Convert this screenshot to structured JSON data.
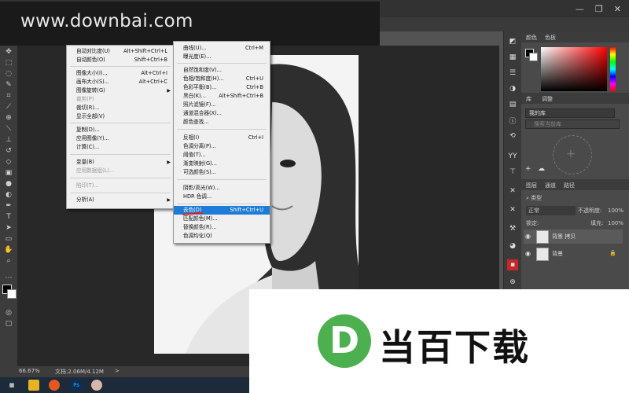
{
  "watermark": {
    "text": "www.downbai.com"
  },
  "image_menu": {
    "items": [
      {
        "label": "自动对比度(U)",
        "shortcut": "Alt+Shift+Ctrl+L",
        "disabled": false
      },
      {
        "label": "自动颜色(O)",
        "shortcut": "Shift+Ctrl+B",
        "disabled": false
      },
      {
        "label": "图像大小(I)...",
        "shortcut": "Alt+Ctrl+I",
        "disabled": false
      },
      {
        "label": "画布大小(S)...",
        "shortcut": "Alt+Ctrl+C",
        "disabled": false
      },
      {
        "label": "图像旋转(G)",
        "shortcut": "",
        "disabled": false
      },
      {
        "label": "裁剪(P)",
        "shortcut": "",
        "disabled": true
      },
      {
        "label": "裁切(R)...",
        "shortcut": "",
        "disabled": false
      },
      {
        "label": "显示全部(V)",
        "shortcut": "",
        "disabled": false
      },
      {
        "label": "复制(D)...",
        "shortcut": "",
        "disabled": false
      },
      {
        "label": "应用图像(Y)...",
        "shortcut": "",
        "disabled": false
      },
      {
        "label": "计算(C)...",
        "shortcut": "",
        "disabled": false
      },
      {
        "label": "变量(B)",
        "shortcut": "",
        "disabled": false
      },
      {
        "label": "应用数据组(L)...",
        "shortcut": "",
        "disabled": true
      },
      {
        "label": "陷印(T)...",
        "shortcut": "",
        "disabled": true
      },
      {
        "label": "分析(A)",
        "shortcut": "",
        "disabled": false
      }
    ]
  },
  "adjust_menu": {
    "items": [
      {
        "label": "曲线(U)...",
        "shortcut": "Ctrl+M"
      },
      {
        "label": "曝光度(E)...",
        "shortcut": ""
      },
      {
        "label": "自然饱和度(V)...",
        "shortcut": ""
      },
      {
        "label": "色相/饱和度(H)...",
        "shortcut": "Ctrl+U"
      },
      {
        "label": "色彩平衡(B)...",
        "shortcut": "Ctrl+B"
      },
      {
        "label": "黑白(K)...",
        "shortcut": "Alt+Shift+Ctrl+B"
      },
      {
        "label": "照片滤镜(F)...",
        "shortcut": ""
      },
      {
        "label": "通道混合器(X)...",
        "shortcut": ""
      },
      {
        "label": "颜色查找...",
        "shortcut": ""
      },
      {
        "label": "反相(I)",
        "shortcut": "Ctrl+I"
      },
      {
        "label": "色调分离(P)...",
        "shortcut": ""
      },
      {
        "label": "阈值(T)...",
        "shortcut": ""
      },
      {
        "label": "渐变映射(G)...",
        "shortcut": ""
      },
      {
        "label": "可选颜色(S)...",
        "shortcut": ""
      },
      {
        "label": "阴影/高光(W)...",
        "shortcut": ""
      },
      {
        "label": "HDR 色调...",
        "shortcut": ""
      },
      {
        "label": "去色(D)",
        "shortcut": "Shift+Ctrl+U"
      },
      {
        "label": "匹配颜色(M)...",
        "shortcut": ""
      },
      {
        "label": "替换颜色(R)...",
        "shortcut": ""
      },
      {
        "label": "色调均化(Q)",
        "shortcut": ""
      }
    ],
    "highlighted": "去色(D)"
  },
  "panels": {
    "color_tabs": [
      "颜色",
      "色板"
    ],
    "library_tabs": [
      "库",
      "调整"
    ],
    "library_select": "我的库",
    "library_search_placeholder": "搜索当前库",
    "layers_tabs": [
      "图层",
      "通道",
      "路径"
    ],
    "filter_label": "类型",
    "blend_mode": "正常",
    "opacity_label": "不透明度:",
    "opacity_value": "100%",
    "lock_label": "锁定:",
    "fill_label": "填充:",
    "fill_value": "100%",
    "layers": [
      {
        "name": "背景 拷贝",
        "locked": false
      },
      {
        "name": "背景",
        "locked": true
      }
    ]
  },
  "status": {
    "zoom": "66.67%",
    "doc": "文档:2.06M/4.12M"
  },
  "brand": {
    "logo_letter": "D",
    "name": "当百下载",
    "logo_color": "#4caf50"
  },
  "icons": {
    "toolbar": [
      "move-icon",
      "marquee-icon",
      "lasso-icon",
      "quick-select-icon",
      "crop-icon",
      "eyedropper-icon",
      "healing-icon",
      "brush-icon",
      "stamp-icon",
      "history-brush-icon",
      "eraser-icon",
      "gradient-icon",
      "blur-icon",
      "dodge-icon",
      "pen-icon",
      "type-icon",
      "path-select-icon",
      "shape-icon",
      "hand-icon",
      "zoom-icon"
    ],
    "strip": [
      "color-icon",
      "swatches-icon",
      "library-icon",
      "adjust-icon",
      "layers-icon",
      "channels-icon",
      "paths-icon"
    ]
  }
}
